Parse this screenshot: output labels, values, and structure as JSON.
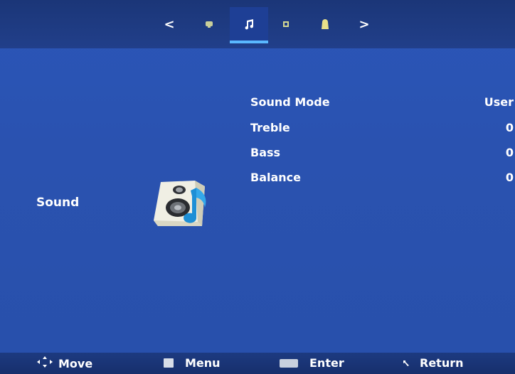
{
  "topbar": {
    "tabs": [
      {
        "icon": "chevron-left-icon",
        "glyph": "<"
      },
      {
        "icon": "picture-icon"
      },
      {
        "icon": "music-note-icon",
        "active": true
      },
      {
        "icon": "clock-icon"
      },
      {
        "icon": "lock-icon"
      },
      {
        "icon": "chevron-right-icon",
        "glyph": ">"
      }
    ]
  },
  "main": {
    "section_label": "Sound",
    "section_icon": "speaker-icon",
    "settings": [
      {
        "label": "Sound Mode",
        "value": "User"
      },
      {
        "label": "Treble",
        "value": "0"
      },
      {
        "label": "Bass",
        "value": "0"
      },
      {
        "label": "Balance",
        "value": "0"
      }
    ]
  },
  "footer": {
    "hints": [
      {
        "icon": "move-arrows-icon",
        "label": "Move"
      },
      {
        "icon": "menu-key-icon",
        "label": "Menu"
      },
      {
        "icon": "ok-key-icon",
        "label": "Enter"
      },
      {
        "icon": "return-arrow-icon",
        "label": "Return"
      }
    ]
  },
  "colors": {
    "background": "#2a53b0",
    "topbar": "#1b3678",
    "active_underline": "#5ab8ff",
    "lock_icon": "#e8e08a"
  }
}
